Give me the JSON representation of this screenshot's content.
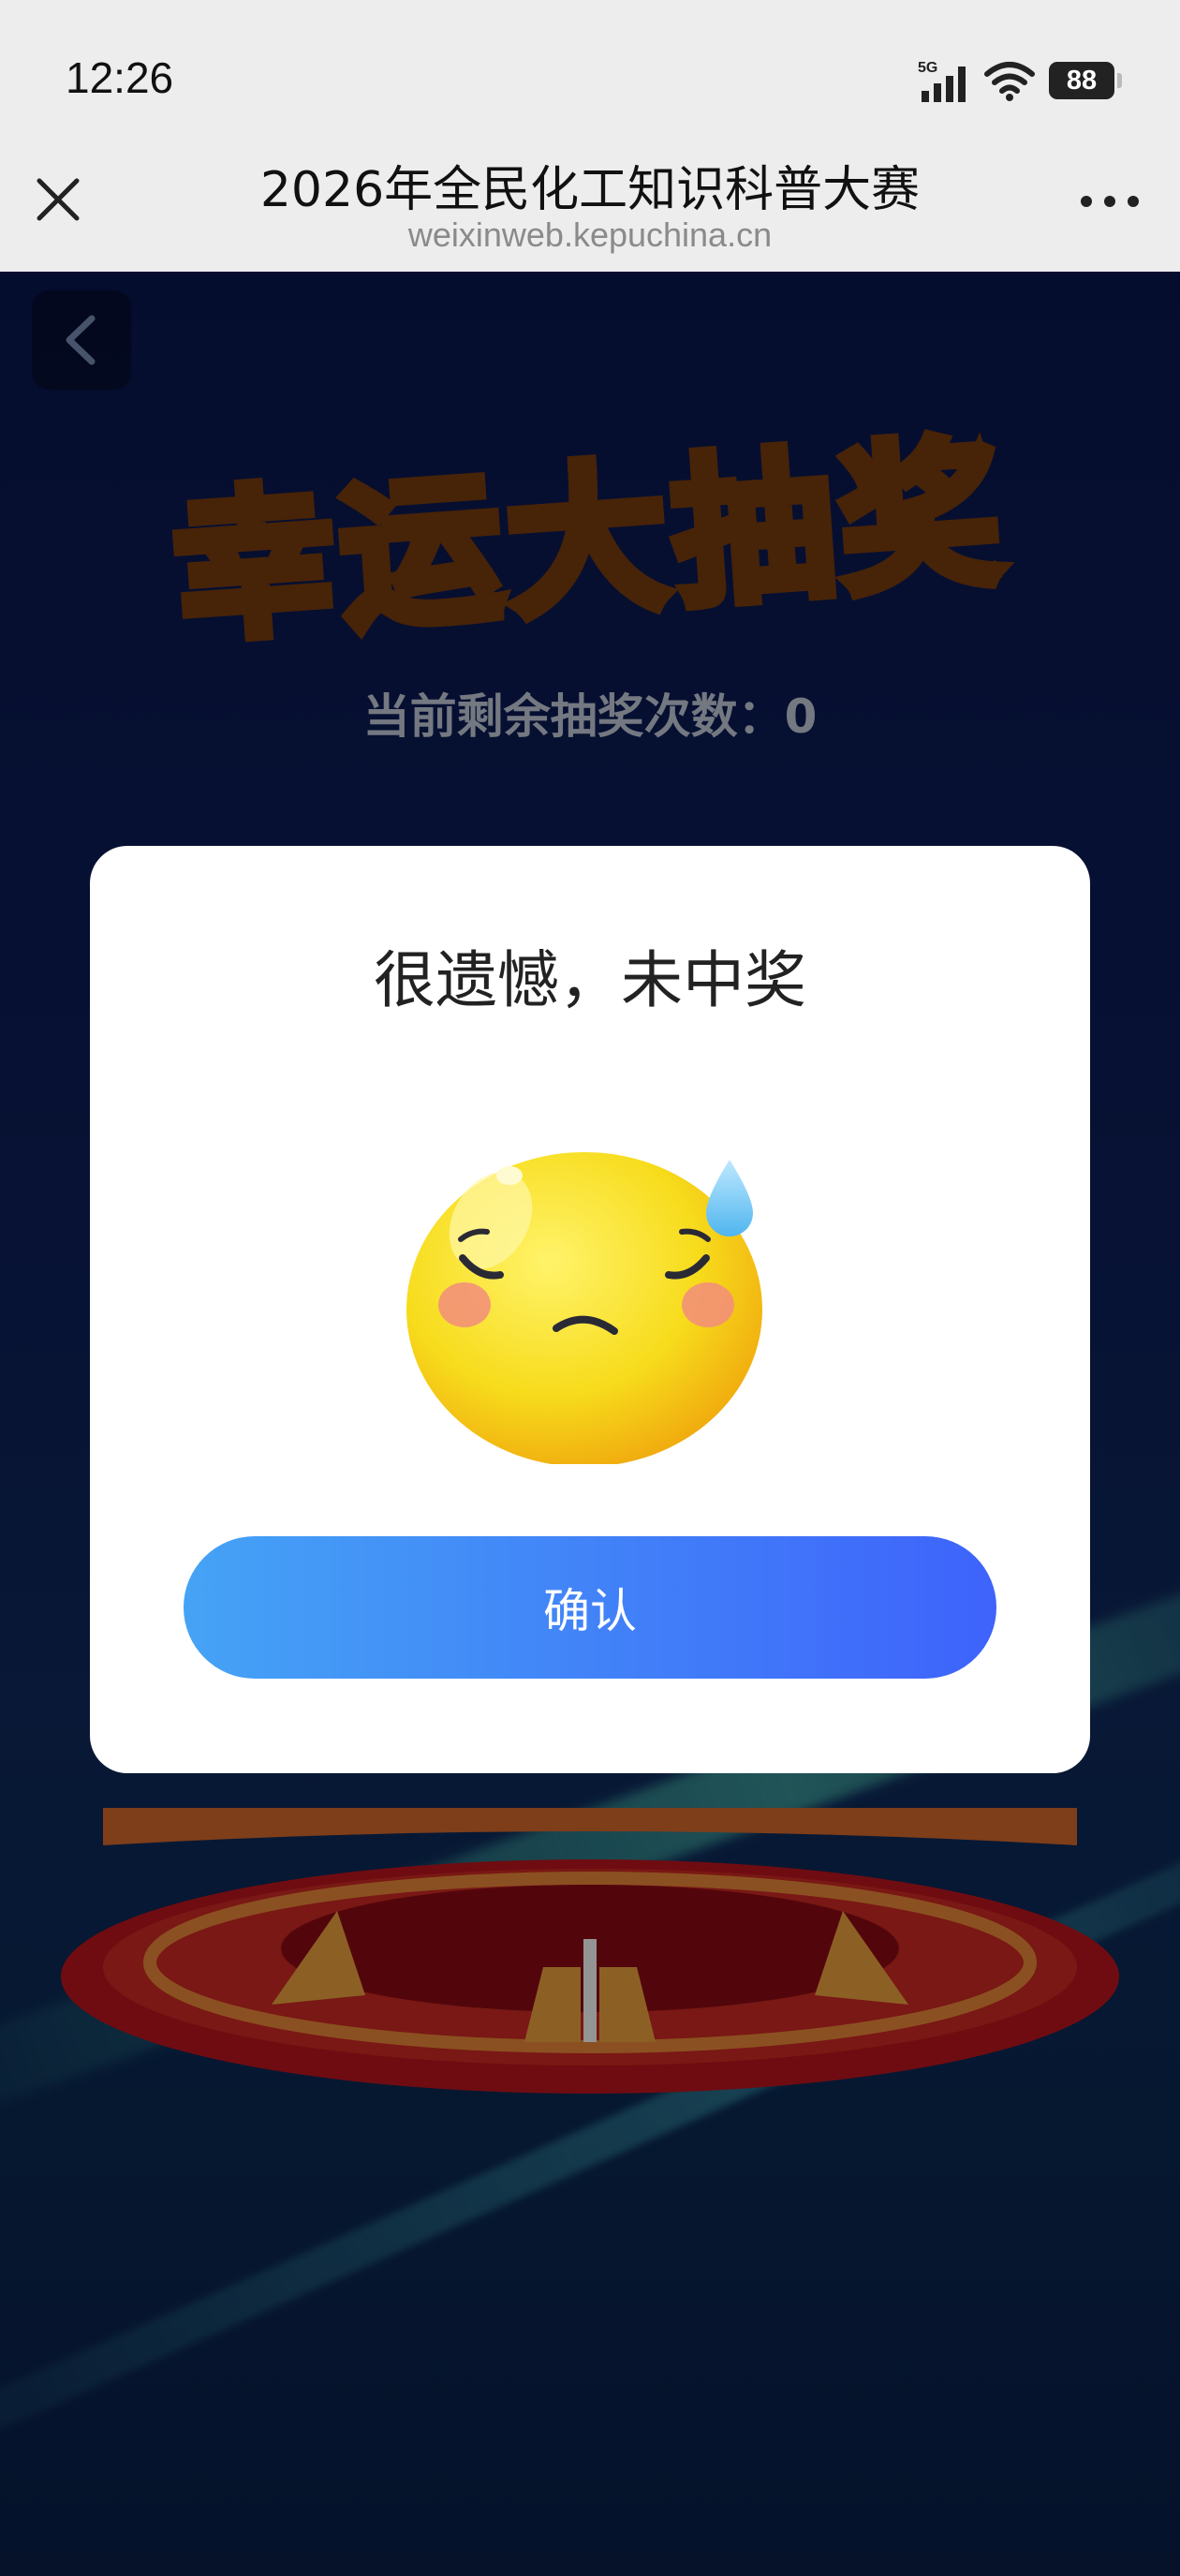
{
  "status_bar": {
    "time": "12:26",
    "network": "5G",
    "battery": "88",
    "icons": [
      "signal-icon",
      "wifi-icon",
      "battery-icon"
    ]
  },
  "title_bar": {
    "title": "2026年全民化工知识科普大赛",
    "url": "weixinweb.kepuchina.cn",
    "icons": [
      "close-icon",
      "more-icon"
    ]
  },
  "page": {
    "lucky_title": "幸运大抽奖",
    "remaining_label": "当前剩余抽奖次数：0",
    "icons": [
      "back-icon"
    ]
  },
  "modal": {
    "title": "很遗憾，未中奖",
    "emoji": "sad-sweat-emoji-icon",
    "confirm_label": "确认"
  },
  "colors": {
    "button_gradient_start": "#45a3f5",
    "button_gradient_end": "#3e63fb",
    "page_background": "#0b1a4c",
    "title_orange": "#f4a43a"
  }
}
